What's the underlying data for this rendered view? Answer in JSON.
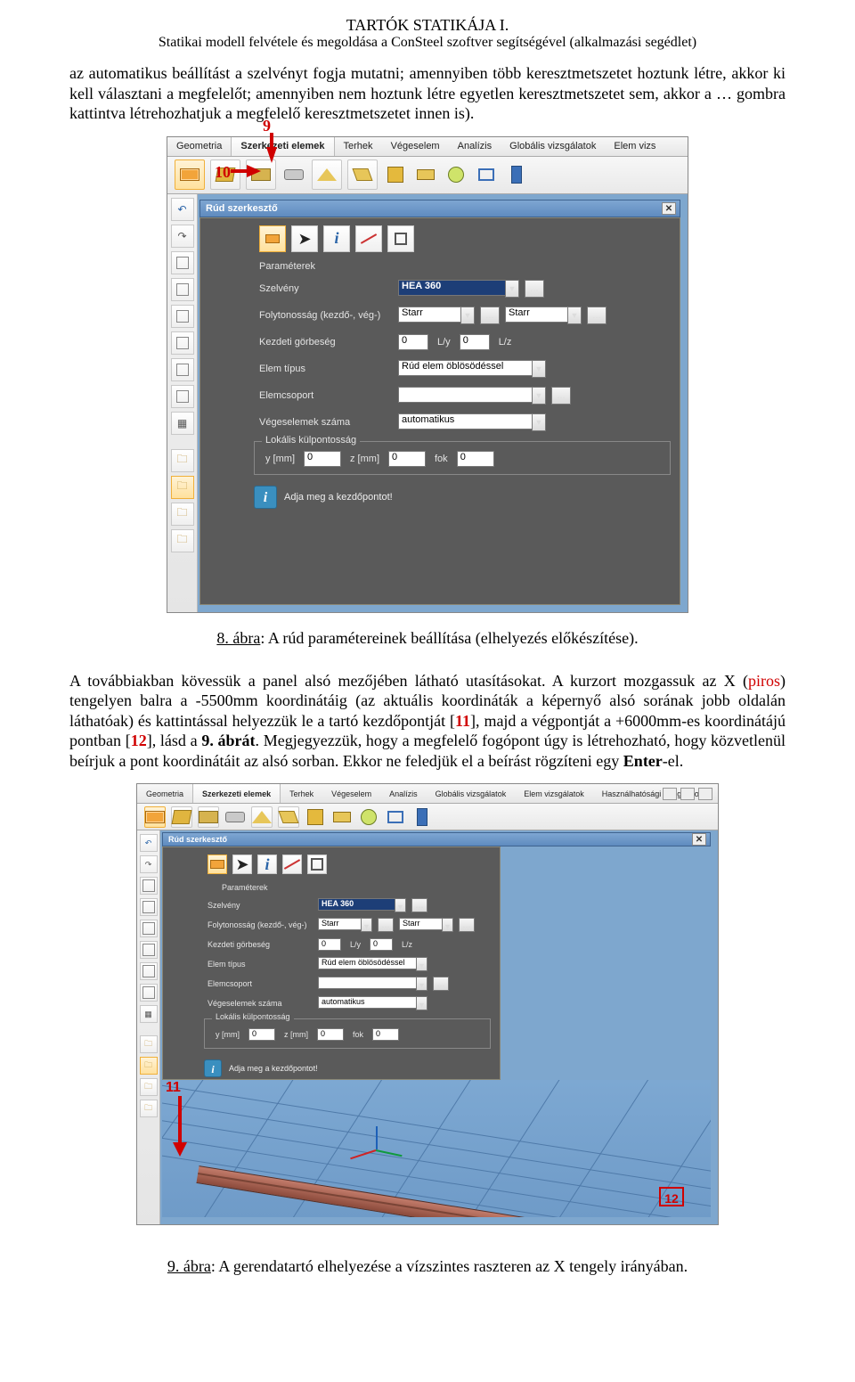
{
  "header": {
    "title": "TARTÓK STATIKÁJA I.",
    "subtitle": "Statikai modell felvétele és megoldása a ConSteel szoftver segítségével (alkalmazási segédlet)"
  },
  "para1_a": "az automatikus beállítást a szelvényt fogja mutatni; amennyiben több keresztmetszetet hoztunk létre, akkor ki kell választani a megfelelőt; amennyiben nem hoztunk létre egyetlen keresztmetszetet sem, akkor a … gombra kattintva létrehozhatjuk a megfelelő keresztmetszetet innen is).",
  "markers": {
    "m9": "9",
    "m10": "10",
    "m11": "11",
    "m12": "12"
  },
  "fig8": {
    "num": "8. ábra",
    "text": ": A rúd  paramétereinek beállítása (elhelyezés előkészítése)."
  },
  "para2_a": "A továbbiakban kövessük a panel alsó mezőjében látható utasításokat. A kurzort mozgassuk az X (",
  "para2_piros": "piros",
  "para2_b": ") tengelyen balra a -5500mm koordinátáig (az aktuális koordináták a képernyő alsó sorának jobb oldalán láthatóak) és kattintással helyezzük le a tartó kezdőpontját [",
  "para2_m11": "11",
  "para2_c": "], majd a végpontját a +6000mm-es koordinátájú pontban [",
  "para2_m12": "12",
  "para2_d": "], lásd a ",
  "para2_bold": "9. ábrát",
  "para2_e": ". Megjegyezzük, hogy a megfelelő fogópont úgy is létrehozható, hogy közvetlenül beírjuk a pont koordinátáit az alsó sorban. Ekkor ne feledjük el a beírást rögzíteni egy ",
  "para2_enter": "Enter",
  "para2_f": "-el.",
  "fig9": {
    "num": "9. ábra",
    "text": ": A gerendatartó elhelyezése a vízszintes raszteren az X tengely irányában."
  },
  "ui": {
    "tabs": [
      "Geometria",
      "Szerkezeti elemek",
      "Terhek",
      "Végeselem",
      "Analízis",
      "Globális vizsgálatok",
      "Elem vizs"
    ],
    "tabs2": [
      "Geometria",
      "Szerkezeti elemek",
      "Terhek",
      "Végeselem",
      "Analízis",
      "Globális vizsgálatok",
      "Elem vizsgálatok",
      "Használhatósági vizsgálatok"
    ],
    "panel_title": "Rúd szerkesztő",
    "params_title": "Paraméterek",
    "labels": {
      "section": "Szelvény",
      "continuity": "Folytonosság (kezdő-, vég-)",
      "curvature": "Kezdeti görbeség",
      "type": "Elem típus",
      "group": "Elemcsoport",
      "fe": "Végeselemek száma",
      "local": "Lokális külpontosság",
      "y": "y [mm]",
      "z": "z [mm]",
      "rot": "fok"
    },
    "values": {
      "section": "HEA 360",
      "continuity1": "Starr",
      "continuity2": "Starr",
      "ly": "0",
      "lyu": "L/y",
      "lz": "0",
      "lzu": "L/z",
      "type": "Rúd elem öblösödéssel",
      "group": "",
      "fe": "automatikus",
      "y": "0",
      "z": "0",
      "rot": "0"
    },
    "info": "Adja meg a kezdőpontot!",
    "dots": "..."
  }
}
